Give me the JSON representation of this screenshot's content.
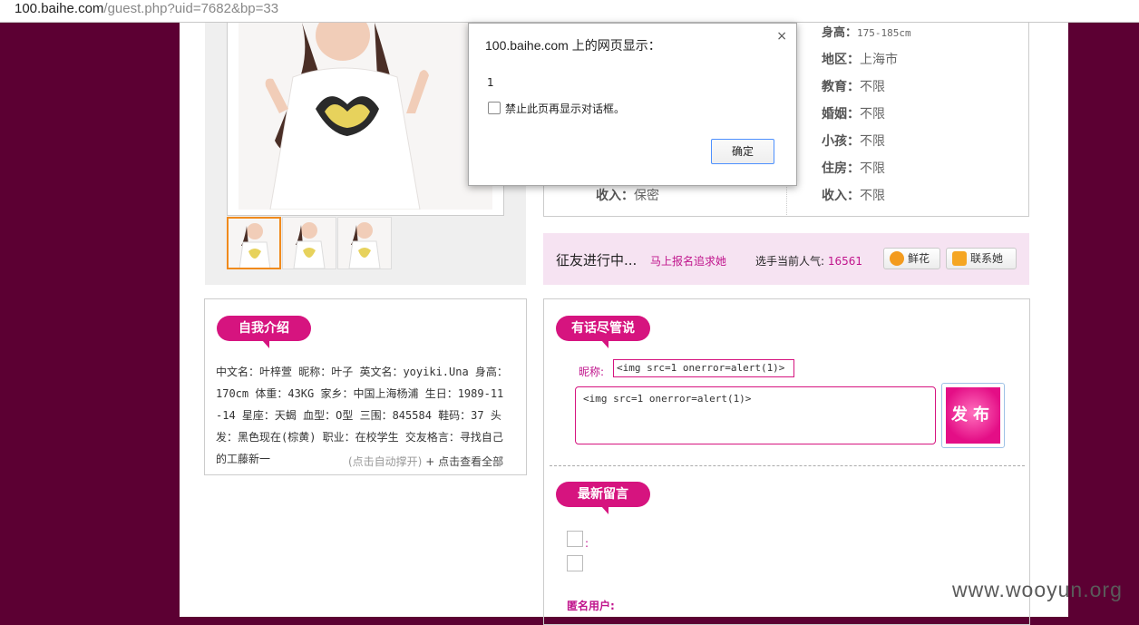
{
  "browser": {
    "url_host": "100.baihe.com",
    "url_path": "/guest.php?uid=7682&bp=33"
  },
  "profile_info": {
    "left": [
      {
        "label": "收入：",
        "value": "保密"
      }
    ],
    "right": [
      {
        "label": "身高：",
        "value": "175-185cm"
      },
      {
        "label": "地区：",
        "value": "上海市"
      },
      {
        "label": "教育：",
        "value": "不限"
      },
      {
        "label": "婚姻：",
        "value": "不限"
      },
      {
        "label": "小孩：",
        "value": "不限"
      },
      {
        "label": "住房：",
        "value": "不限"
      },
      {
        "label": "收入：",
        "value": "不限"
      }
    ]
  },
  "friend_bar": {
    "status": "征友进行中...",
    "apply_link": "马上报名追求她",
    "popularity_label": "选手当前人气:",
    "popularity_value": "16561",
    "flower_button": "鲜花",
    "contact_button": "联系她"
  },
  "intro": {
    "title": "自我介绍",
    "text": "中文名：叶梓萱 昵称：叶子 英文名：yoyiki.Una 身高：170cm 体重：43KG 家乡：中国上海杨浦 生日：1989-11-14 星座：天蝎 血型：O型 三围：845584 鞋码：37 头发：黑色现在(棕黄) 职业：在校学生 交友格言：寻找自己的工藤新一",
    "expand_hint": "(点击自动撑开)",
    "view_all": "+ 点击查看全部"
  },
  "say": {
    "title": "有话尽管说",
    "nickname_label": "昵称:",
    "nickname_value": "<img src=1 onerror=alert(1)>",
    "message_value": "<img src=1 onerror=alert(1)>",
    "publish_label": "发布"
  },
  "latest": {
    "title": "最新留言",
    "colon": ":",
    "anon_user": "匿名用户:"
  },
  "dialog": {
    "title": "100.baihe.com 上的网页显示：",
    "message": "1",
    "checkbox_label": "禁止此页再显示对话框。",
    "ok_label": "确定",
    "close_glyph": "×"
  },
  "watermark": "www.wooyun.org"
}
